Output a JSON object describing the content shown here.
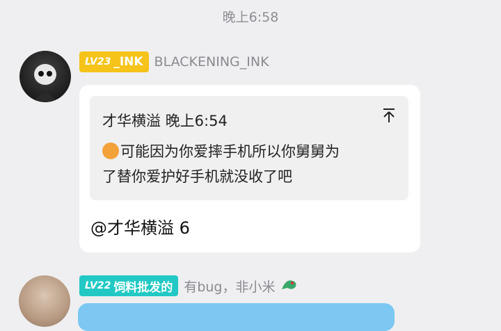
{
  "time_divider": "晚上6:58",
  "messages": [
    {
      "badge": {
        "level": "LV23",
        "tag": "_INK"
      },
      "username": "BLACKENING_INK",
      "quote": {
        "author_time": "才华横溢 晚上6:54",
        "pin_icon": "pin-icon",
        "text_line1": "可能因为你爱摔手机所以你舅舅为",
        "text_line2": "了替你爱护好手机就没收了吧"
      },
      "reply": "@才华横溢 6"
    },
    {
      "badge": {
        "level": "LV22",
        "tag": "饲料批发的"
      },
      "username": "有bug，非小米",
      "pet_icon": "dragon-icon"
    }
  ]
}
